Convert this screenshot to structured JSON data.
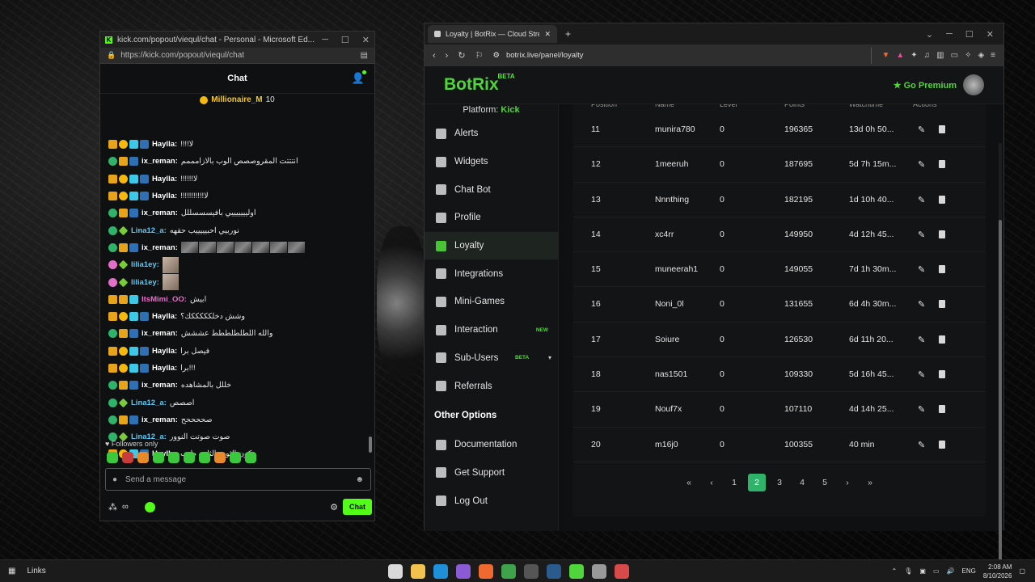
{
  "edge": {
    "tab_title": "kick.com/popout/viequl/chat - Personal - Microsoft Ed...",
    "url": "https://kick.com/popout/viequl/chat",
    "chat_header": "Chat",
    "pinned_name": "Millionaire_M",
    "pinned_count": "10",
    "messages": [
      {
        "user": "Haylla:",
        "text": "!!!!لا",
        "color": "#ffffff"
      },
      {
        "user": "ix_reman:",
        "text": "انتتتت المقروصصص الوب بالازامممم",
        "color": "#ffffff"
      },
      {
        "user": "Haylla:",
        "text": "!!!!!!لا",
        "color": "#ffffff"
      },
      {
        "user": "Haylla:",
        "text": "!!!!!!!!!!!لا",
        "color": "#ffffff"
      },
      {
        "user": "ix_reman:",
        "text": "اوليييييييي بافيسسسللل",
        "color": "#ffffff"
      },
      {
        "user": "Lina12_a:",
        "text": "نوربيي احبيييييب حقهه",
        "color": "#5bc8f5"
      },
      {
        "user": "ix_reman:",
        "text": "",
        "color": "#ffffff"
      },
      {
        "user": "lilia1ey:",
        "text": "",
        "color": "#5bc8f5"
      },
      {
        "user": "lilia1ey:",
        "text": "",
        "color": "#5bc8f5"
      },
      {
        "user": "ItsMimi_OO:",
        "text": "ابيش",
        "color": "#e46fc8"
      },
      {
        "user": "Haylla:",
        "text": "وشش دخلكككككك؟",
        "color": "#ffffff"
      },
      {
        "user": "ix_reman:",
        "text": "والله اللطلطلططط عششش",
        "color": "#ffffff"
      },
      {
        "user": "Haylla:",
        "text": "فيصل برا",
        "color": "#ffffff"
      },
      {
        "user": "Haylla:",
        "text": "برا!!!",
        "color": "#ffffff"
      },
      {
        "user": "ix_reman:",
        "text": "خللل بالمشاهده",
        "color": "#ffffff"
      },
      {
        "user": "Lina12_a:",
        "text": "اصصص",
        "color": "#5bc8f5"
      },
      {
        "user": "ix_reman:",
        "text": "صححححح",
        "color": "#ffffff"
      },
      {
        "user": "Lina12_a:",
        "text": "صوت صوتت النوور",
        "color": "#5bc8f5"
      },
      {
        "user": "Haylla:",
        "text": "يكون الثوب الثاني طيب",
        "color": "#ffffff"
      }
    ],
    "followers_only": "Followers only",
    "send_placeholder": "Send a message",
    "infinity": "∞",
    "chat_button": "Chat"
  },
  "brave": {
    "tab_title": "Loyalty | BotRix — Cloud Stream",
    "url": "botrix.live/panel/loyalty",
    "brand": "BotRix",
    "brand_tag": "BETA",
    "premium": "Go Premium",
    "platform_label": "Platform:",
    "platform_value": "Kick",
    "nav": [
      {
        "label": "Alerts",
        "icon": "alert-icon"
      },
      {
        "label": "Widgets",
        "icon": "widgets-icon"
      },
      {
        "label": "Chat Bot",
        "icon": "robot-icon"
      },
      {
        "label": "Profile",
        "icon": "profile-card-icon"
      },
      {
        "label": "Loyalty",
        "icon": "trophy-icon",
        "active": true
      },
      {
        "label": "Integrations",
        "icon": "integrations-icon"
      },
      {
        "label": "Mini-Games",
        "icon": "gamepad-icon"
      },
      {
        "label": "Interaction",
        "icon": "music-icon",
        "tag": "NEW"
      },
      {
        "label": "Sub-Users",
        "icon": "users-icon",
        "tag": "BETA",
        "expandable": true
      },
      {
        "label": "Referrals",
        "icon": "referrals-icon"
      }
    ],
    "other_options": "Other Options",
    "other_nav": [
      {
        "label": "Documentation",
        "icon": "docs-icon"
      },
      {
        "label": "Get Support",
        "icon": "question-icon"
      },
      {
        "label": "Log Out",
        "icon": "logout-icon"
      }
    ],
    "columns": [
      "Position",
      "Name",
      "Level",
      "Points",
      "Watchtime",
      "Actions"
    ],
    "rows": [
      [
        "11",
        "munira780",
        "0",
        "196365",
        "13d 0h 50..."
      ],
      [
        "12",
        "1meeruh",
        "0",
        "187695",
        "5d 7h 15m..."
      ],
      [
        "13",
        "Nnnthing",
        "0",
        "182195",
        "1d 10h 40..."
      ],
      [
        "14",
        "xc4rr",
        "0",
        "149950",
        "4d 12h 45..."
      ],
      [
        "15",
        "muneerah1",
        "0",
        "149055",
        "7d 1h 30m..."
      ],
      [
        "16",
        "Noni_0l",
        "0",
        "131655",
        "6d 4h 30m..."
      ],
      [
        "17",
        "Soiure",
        "0",
        "126530",
        "6d 11h 20..."
      ],
      [
        "18",
        "nas1501",
        "0",
        "109330",
        "5d 16h 45..."
      ],
      [
        "19",
        "Nouf7x",
        "0",
        "107110",
        "4d 14h 25..."
      ],
      [
        "20",
        "m16j0",
        "0",
        "100355",
        "40 min"
      ]
    ],
    "pages": [
      "1",
      "2",
      "3",
      "4",
      "5"
    ],
    "current_page": "2"
  },
  "taskbar": {
    "links": "Links",
    "lang": "ENG",
    "time": "2:08 AM",
    "date": "8/10/2026"
  }
}
